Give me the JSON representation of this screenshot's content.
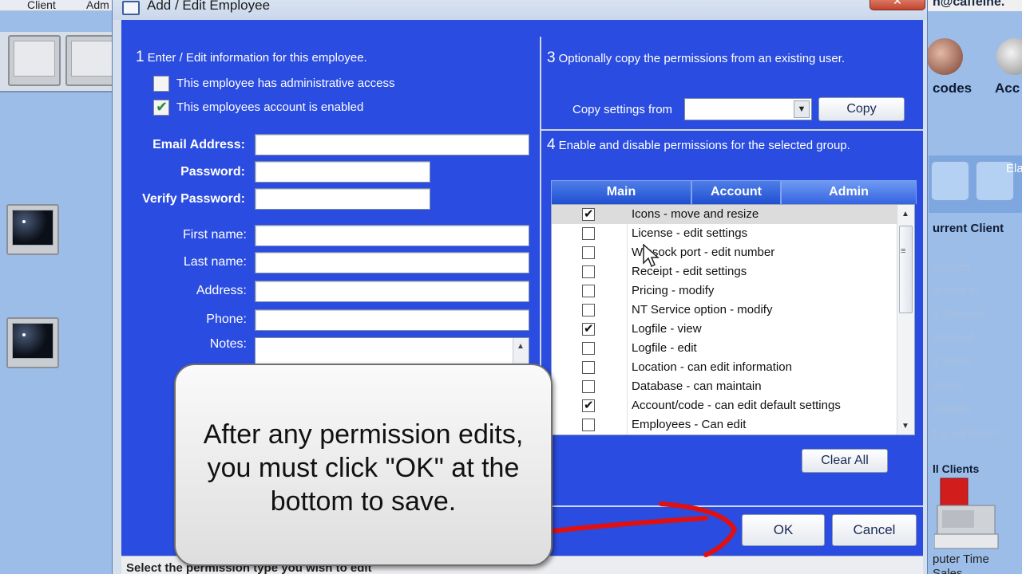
{
  "background": {
    "menu": [
      "Client",
      "Adm"
    ],
    "email": "n@caffeine.",
    "tools": [
      "codes",
      "Acc"
    ],
    "pill_label": "Ela",
    "section_current": "urrent Client",
    "current_items": [
      "ssages",
      "ansfer to...",
      "d Session",
      "nlocked",
      "d Items...",
      "eboot",
      "utdown",
      "t to windows"
    ],
    "section_all": "ll Clients",
    "all_items": [
      "puter Time",
      "Sales"
    ]
  },
  "dialog": {
    "title": "Add / Edit Employee",
    "close_label": "✕",
    "section1": {
      "number": "1",
      "text": "Enter / Edit information for this employee."
    },
    "admin_checkbox": {
      "label": "This employee has administrative access",
      "checked": false
    },
    "enabled_checkbox": {
      "label": "This employees account is enabled",
      "checked": true
    },
    "fields": {
      "email_label": "Email Address:",
      "password_label": "Password:",
      "verify_label": "Verify Password:",
      "first_label": "First name:",
      "last_label": "Last name:",
      "address_label": "Address:",
      "phone_label": "Phone:",
      "notes_label": "Notes:"
    },
    "section3": {
      "number": "3",
      "text": "Optionally copy the permissions from an existing user."
    },
    "copy_from_label": "Copy settings from",
    "copy_from_value": "",
    "copy_button": "Copy",
    "section4": {
      "number": "4",
      "text": "Enable and disable permissions for the selected group."
    },
    "tabs": [
      "Main",
      "Account",
      "Admin"
    ],
    "active_tab": "Admin",
    "permissions": [
      {
        "label": "Icons - move and resize",
        "checked": true,
        "selected": true
      },
      {
        "label": "License - edit settings",
        "checked": false
      },
      {
        "label": "Winsock port - edit number",
        "checked": false
      },
      {
        "label": "Receipt - edit settings",
        "checked": false
      },
      {
        "label": "Pricing - modify",
        "checked": false
      },
      {
        "label": "NT Service option - modify",
        "checked": false
      },
      {
        "label": "Logfile - view",
        "checked": true
      },
      {
        "label": "Logfile - edit",
        "checked": false
      },
      {
        "label": "Location - can edit information",
        "checked": false
      },
      {
        "label": "Database - can maintain",
        "checked": false
      },
      {
        "label": "Account/code - can edit default settings",
        "checked": true
      },
      {
        "label": "Employees - Can edit",
        "checked": false
      }
    ],
    "clear_all_button": "Clear All",
    "ok_button": "OK",
    "cancel_button": "Cancel",
    "status_text": "Select the permission type you wish to edit"
  },
  "annotation": {
    "callout_text": "After any permission edits, you must click \"OK\" at the bottom to save.",
    "arrow_color": "#e01010"
  }
}
